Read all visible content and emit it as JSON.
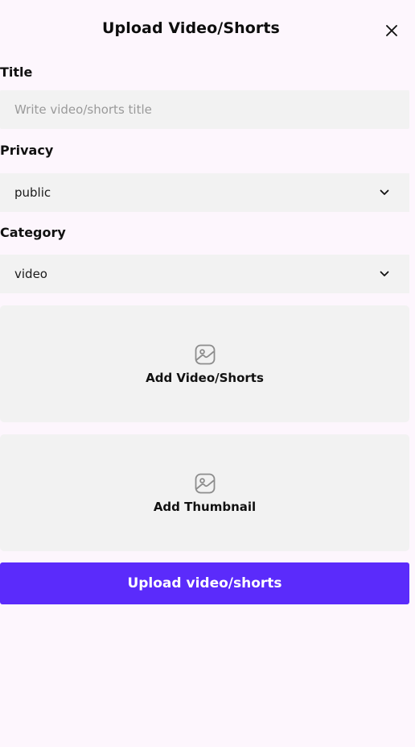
{
  "header": {
    "title": "Upload Video/Shorts",
    "close_icon": "close-icon"
  },
  "form": {
    "title": {
      "label": "Title",
      "value": "",
      "placeholder": "Write video/shorts title"
    },
    "privacy": {
      "label": "Privacy",
      "selected": "public",
      "icon": "chevron-down-icon"
    },
    "category": {
      "label": "Category",
      "selected": "video",
      "icon": "chevron-down-icon"
    },
    "video_upload": {
      "label": "Add Video/Shorts",
      "icon": "image-icon"
    },
    "thumbnail_upload": {
      "label": "Add Thumbnail",
      "icon": "image-icon"
    },
    "submit_label": "Upload video/shorts"
  },
  "colors": {
    "background": "#fdf6fd",
    "field_background": "#f2f2f2",
    "accent": "#5b2bfb",
    "placeholder": "#9a9a9a"
  }
}
